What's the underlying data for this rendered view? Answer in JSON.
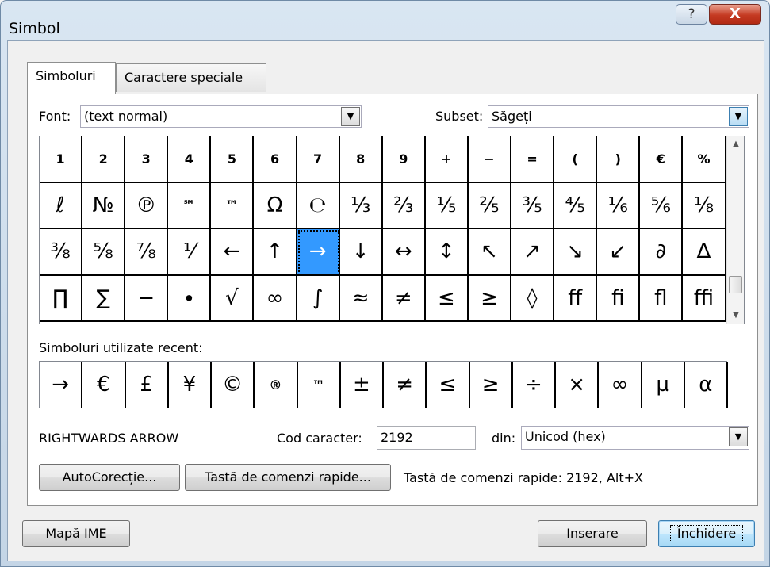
{
  "window": {
    "title": "Simbol",
    "help_button": "?",
    "close_button": "X"
  },
  "tabs": [
    {
      "label": "Simboluri",
      "active": true
    },
    {
      "label": "Caractere speciale",
      "active": false
    }
  ],
  "font": {
    "label": "Font:",
    "value": "(text normal)"
  },
  "subset": {
    "label": "Subset:",
    "value": "Săgeți"
  },
  "symbols": [
    [
      "1",
      "2",
      "3",
      "4",
      "5",
      "6",
      "7",
      "8",
      "9",
      "+",
      "−",
      "=",
      "(",
      ")",
      "€",
      "%"
    ],
    [
      "ℓ",
      "№",
      "℗",
      "℠",
      "™",
      "Ω",
      "℮",
      "⅓",
      "⅔",
      "⅕",
      "⅖",
      "⅗",
      "⅘",
      "⅙",
      "⅚",
      "⅛"
    ],
    [
      "⅜",
      "⅝",
      "⅞",
      "⅟",
      "←",
      "↑",
      "→",
      "↓",
      "↔",
      "↕",
      "↖",
      "↗",
      "↘",
      "↙",
      "∂",
      "∆"
    ],
    [
      "∏",
      "∑",
      "−",
      "∙",
      "√",
      "∞",
      "∫",
      "≈",
      "≠",
      "≤",
      "≥",
      "◊",
      "ﬀ",
      "ﬁ",
      "ﬂ",
      "ﬃ"
    ]
  ],
  "small_symbol_rows": [
    0
  ],
  "small_symbols": [
    "℠",
    "™"
  ],
  "selected": {
    "row": 2,
    "col": 6
  },
  "recent": {
    "label": "Simboluri utilizate recent:",
    "items": [
      "→",
      "€",
      "£",
      "¥",
      "©",
      "®",
      "™",
      "±",
      "≠",
      "≤",
      "≥",
      "÷",
      "×",
      "∞",
      "µ",
      "α"
    ]
  },
  "char_name": "RIGHTWARDS ARROW",
  "char_code": {
    "label": "Cod caracter:",
    "value": "2192"
  },
  "from": {
    "label": "din:",
    "value": "Unicod (hex)"
  },
  "buttons": {
    "autocorrect": "AutoCorecție...",
    "shortcut_key": "Tastă de comenzi rapide...",
    "ime_map": "Mapă IME",
    "insert": "Inserare",
    "close": "Închidere"
  },
  "shortcut_text": "Tastă de comenzi rapide: 2192, Alt+X",
  "colors": {
    "selection": "#3399ff",
    "window_frame": "#c4d5e6",
    "close_red": "#c53a22"
  }
}
